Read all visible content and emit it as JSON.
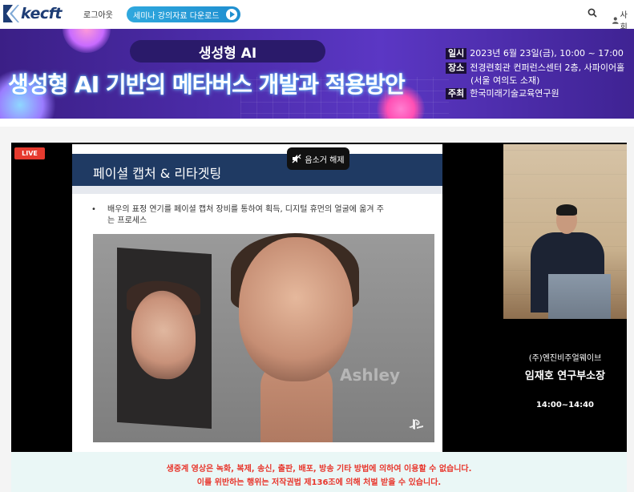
{
  "header": {
    "logo_text": "kecft",
    "login_label": "로그아웃",
    "seminar_button_label": "세미나 강의자료 다운로드",
    "user_label": "사회"
  },
  "banner": {
    "pill_title": "생성형 AI",
    "main_title": "생성형 AI 기반의 메타버스 개발과 적용방안",
    "info": [
      {
        "tag": "일시",
        "text": "2023년 6월 23일(금), 10:00 ~ 17:00"
      },
      {
        "tag": "장소",
        "text": "전경련회관 컨퍼런스센터 2층, 사파이어홀"
      },
      {
        "tag": "",
        "text": "(서울 여의도 소재)"
      },
      {
        "tag": "주최",
        "text": "한국미래기술교육연구원"
      }
    ]
  },
  "player": {
    "live_label": "LIVE",
    "mute_label": "음소거 해제",
    "slide_title": "페이셜 캡처 & 리타겟팅",
    "bullet_line1": "배우의 표정 연기를 페이셜 캡처 장비를 통하여 획득, 디지털 휴먼의 얼굴에 옮겨 주",
    "bullet_line2": "는 프로세스",
    "watermark_name": "Ashley",
    "presenter_org": "(주)엔진비주얼웨이브",
    "presenter_name": "임재호 연구부소장",
    "time_slot": "14:00~14:40"
  },
  "notice": {
    "line1": "생중계 영상은 녹화, 복제, 송신, 출판, 배포, 방송 기타 방법에 의하여 이용할 수 없습니다.",
    "line2": "이를 위반하는 행위는 저작권법 제136조에 의해 처벌 받을 수 있습니다."
  },
  "colors": {
    "accent": "#1f8fd0",
    "live": "#e63a2e",
    "notice_text": "#e8362c",
    "slide_header": "#1f3a63"
  },
  "icons": [
    "search-icon",
    "user-icon",
    "play-icon",
    "mute-icon",
    "playstation-icon"
  ]
}
